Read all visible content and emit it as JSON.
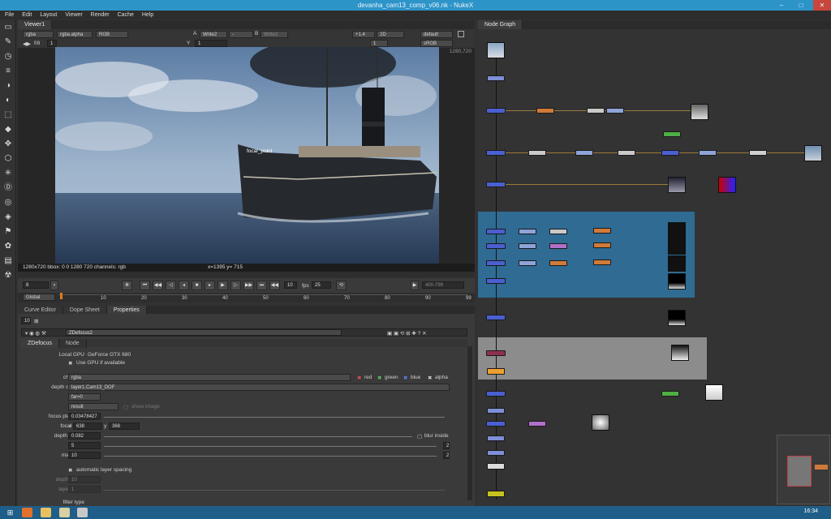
{
  "window": {
    "title": "devanha_cam13_comp_v06.nk - NukeX",
    "minimize": "–",
    "maximize": "□",
    "close": "✕"
  },
  "menu": [
    "File",
    "Edit",
    "Layout",
    "Viewer",
    "Render",
    "Cache",
    "Help"
  ],
  "viewer": {
    "tab": "Viewer1",
    "channels": "rgba",
    "alpha_channel": "rgba.alpha",
    "colorspace_in": "RGB",
    "input_a_label": "A",
    "input_a": "Write2",
    "wipe": "-",
    "input_b_label": "B",
    "input_b": "Write2",
    "gain": "+1.4",
    "view_mode": "2D",
    "lut": "default",
    "output_lut": "sRGB",
    "fstop_label": "f/8",
    "frame_step": "1",
    "y_label": "Y",
    "y_value": "1",
    "proxy": "1",
    "resolution_tag": "1280,720",
    "focal_label": "focal_point",
    "status_left": "1280x720 bbox: 0 0 1280 720 channels: rgb",
    "status_coords": "x=1395 y= 715"
  },
  "transport": {
    "current_frame": "8",
    "increment": "10",
    "fps_label": "fps",
    "fps": "25",
    "range": "400-799",
    "scope": "Global",
    "ticks": [
      "0",
      "10",
      "20",
      "30",
      "40",
      "50",
      "60",
      "70",
      "80",
      "90",
      "99"
    ]
  },
  "panel_tabs": [
    "Curve Editor",
    "Dope Sheet",
    "Properties"
  ],
  "properties": {
    "max_panels": "10",
    "node_name": "ZDefocus2",
    "subtabs": [
      "ZDefocus",
      "Node"
    ],
    "local_gpu_label": "Local GPU",
    "local_gpu": "GeForce GTX 680",
    "use_gpu": "Use GPU if available",
    "channels_label": "channels",
    "channels": "rgba",
    "channel_toggles": [
      "red",
      "green",
      "blue",
      "alpha"
    ],
    "depth_channel_label": "depth channel",
    "depth_channel": "layer1.Cam13_DOF",
    "math_label": "math",
    "math": "far=0",
    "output_label": "output",
    "output": "result",
    "show_image": "show image",
    "focus_plane_label": "focus plane (C)",
    "focus_plane": "0.03478427",
    "focal_point_label": "focal point",
    "focal_x_label": "x",
    "focal_x": "638",
    "focal_y_label": "y",
    "focal_y": "368",
    "dof_label": "depth of field",
    "dof": "0.082",
    "blur_inside": "blur inside",
    "size_label": "size",
    "size": "5",
    "maximum_label": "maximum",
    "maximum": "10",
    "auto_layer": "automatic layer spacing",
    "depth_layers_label": "depth layers",
    "depth_layers": "10",
    "layer_curve_label": "layer curve",
    "layer_curve": "1",
    "filter_type_label": "filter type",
    "spin_2": "2"
  },
  "node_graph": {
    "tab": "Node Graph"
  },
  "taskbar": {
    "time": "16:34"
  },
  "colors": {
    "titlebar": "#2d94c8",
    "backdrop_blue": "#2f6b93",
    "backdrop_gray": "#8c8c8c",
    "node_blue": "#4a5fd0",
    "node_orange": "#d07a3a",
    "node_green": "#4fae45",
    "node_yellow": "#c8c21e"
  }
}
